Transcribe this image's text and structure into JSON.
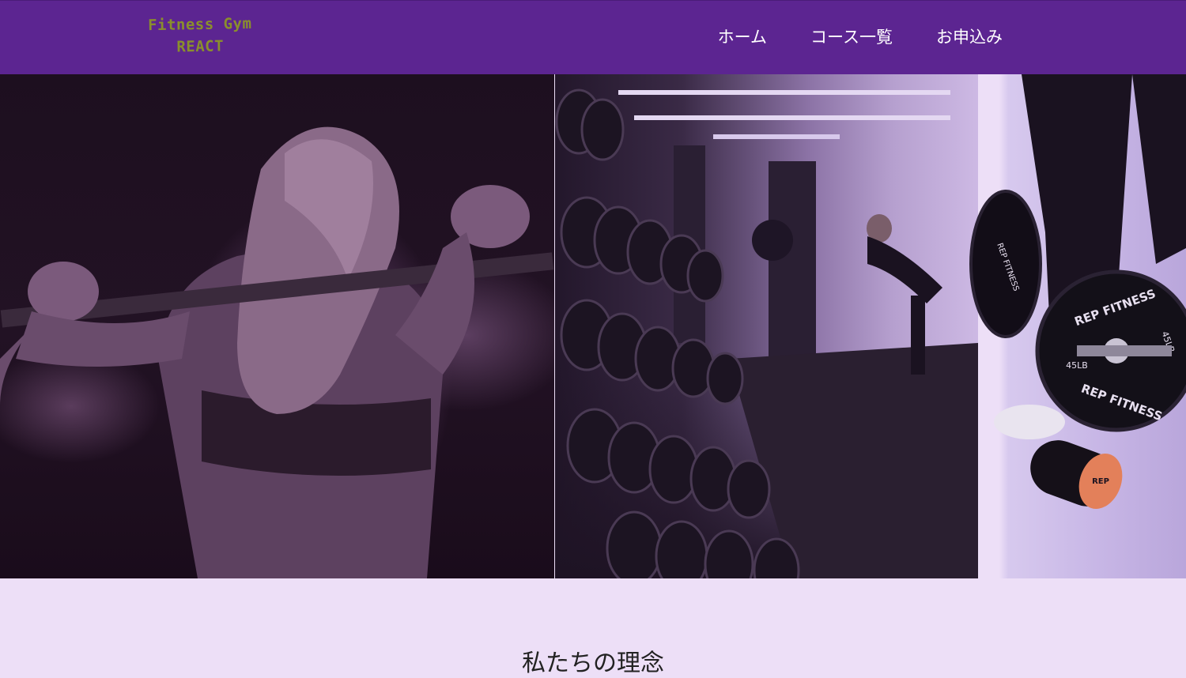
{
  "header": {
    "logo_line1": "Fitness Gym",
    "logo_line2": "REACT",
    "logo_color": "#8a8f2c",
    "background_color": "#5c2591",
    "nav": [
      {
        "label": "ホーム"
      },
      {
        "label": "コース一覧"
      },
      {
        "label": "お申込み"
      }
    ]
  },
  "hero": {
    "plate_text": "REP FITNESS",
    "plate_weight": "45LB",
    "roller_text": "REP"
  },
  "section": {
    "title": "私たちの理念",
    "background_color": "#eddff7"
  }
}
